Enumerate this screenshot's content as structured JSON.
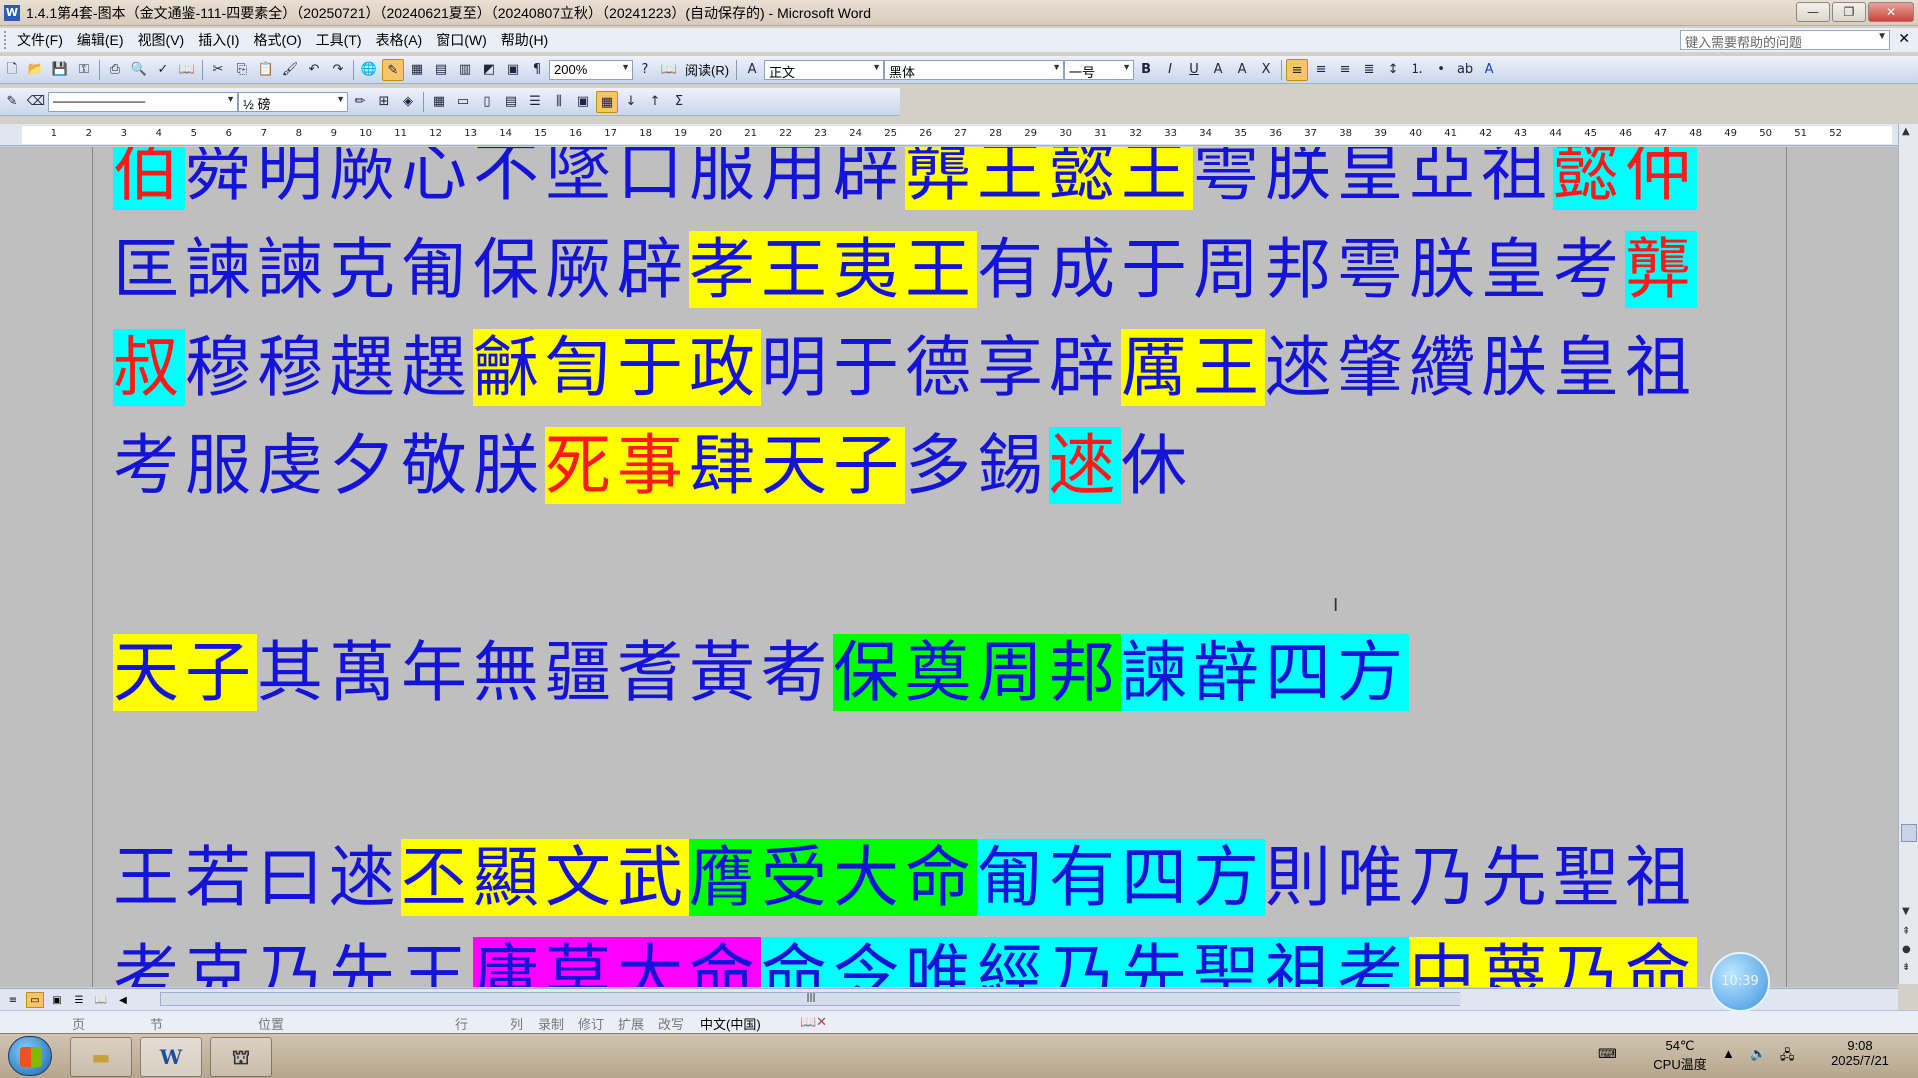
{
  "window": {
    "title": "1.4.1第4套-图本（金文通鉴-111-四要素全）（20250721）（20240621夏至）（20240807立秋）（20241223）(自动保存的) - Microsoft Word",
    "app_icon": "W",
    "buttons": {
      "minimize": "—",
      "maximize": "❐",
      "close": "✕"
    }
  },
  "menu": {
    "items": [
      "文件(F)",
      "编辑(E)",
      "视图(V)",
      "插入(I)",
      "格式(O)",
      "工具(T)",
      "表格(A)",
      "窗口(W)",
      "帮助(H)"
    ],
    "help_placeholder": "键入需要帮助的问题",
    "close_glyph": "✕"
  },
  "toolbar": {
    "zoom": "200%",
    "read_label": "阅读(R)",
    "style": "正文",
    "font": "黑体",
    "size": "一号",
    "bold": "B",
    "italic": "I",
    "underline": "U",
    "border_weight": "½ 磅"
  },
  "ruler": {
    "numbers": [
      "1",
      "2",
      "3",
      "4",
      "5",
      "6",
      "7",
      "8",
      "9",
      "10",
      "11",
      "12",
      "13",
      "14",
      "15",
      "16",
      "17",
      "18",
      "19",
      "20",
      "21",
      "22",
      "23",
      "24",
      "25",
      "26",
      "27",
      "28",
      "29",
      "30",
      "31",
      "32",
      "33",
      "34",
      "35",
      "36",
      "37",
      "38",
      "39",
      "40",
      "41",
      "42",
      "43",
      "44",
      "45",
      "46",
      "47",
      "48",
      "49",
      "50",
      "51",
      "52"
    ]
  },
  "document": {
    "lines": [
      [
        {
          "t": "伯",
          "hl": "c",
          "red": true
        },
        {
          "t": "舜明厥心不墜口服用辟"
        },
        {
          "t": "龏王懿王",
          "hl": "y"
        },
        {
          "t": "雩朕皇亞祖"
        },
        {
          "t": "懿仲",
          "hl": "c",
          "red": true
        }
      ],
      [
        {
          "t": "匡諫諫克匍保厥辟"
        },
        {
          "t": "孝王夷王",
          "hl": "y"
        },
        {
          "t": "有成于周邦雩朕皇考"
        },
        {
          "t": "龏",
          "hl": "c",
          "red": true
        }
      ],
      [
        {
          "t": "叔",
          "hl": "c",
          "red": true
        },
        {
          "t": "穆穆趩趩"
        },
        {
          "t": "龢訇于政",
          "hl": "y"
        },
        {
          "t": "明于德享辟"
        },
        {
          "t": "厲王",
          "hl": "y"
        },
        {
          "t": "逨肇纘朕皇祖"
        }
      ],
      [
        {
          "t": "考服虔夕敬朕"
        },
        {
          "t": "死事",
          "hl": "y",
          "red": true
        },
        {
          "t": "肆天子",
          "hl": "y"
        },
        {
          "t": "多錫"
        },
        {
          "t": "逨",
          "hl": "c",
          "red": true
        },
        {
          "t": "休"
        }
      ],
      [
        {
          "t": "天子",
          "hl": "y"
        },
        {
          "t": "其萬年無疆耆黃耇"
        },
        {
          "t": "保奠周邦",
          "hl": "g"
        },
        {
          "t": "諫辪四方",
          "hl": "c"
        }
      ],
      [
        {
          "t": "王若曰逨"
        },
        {
          "t": "丕顯文武",
          "hl": "y"
        },
        {
          "t": "膺受大命",
          "hl": "g"
        },
        {
          "t": "匍有四方",
          "hl": "c"
        },
        {
          "t": "則唯乃先聖祖"
        }
      ],
      [
        {
          "t": "考克乃先王"
        },
        {
          "t": "庸莫大命",
          "hl": "m"
        },
        {
          "t": "命令唯經乃先聖祖考",
          "hl": "c"
        },
        {
          "t": "中蔑乃命",
          "hl": "y"
        }
      ]
    ]
  },
  "status": {
    "page": "页",
    "section": "节",
    "position": "位置",
    "row": "行",
    "col": "列",
    "record": "录制",
    "revise": "修订",
    "extend": "扩展",
    "overwrite": "改写",
    "language": "中文(中国)"
  },
  "bubble_time": "10:39",
  "taskbar": {
    "temperature": "54℃",
    "cpu_label": "CPU温度",
    "time": "9:08",
    "date": "2025/7/21",
    "word_task": "W"
  }
}
